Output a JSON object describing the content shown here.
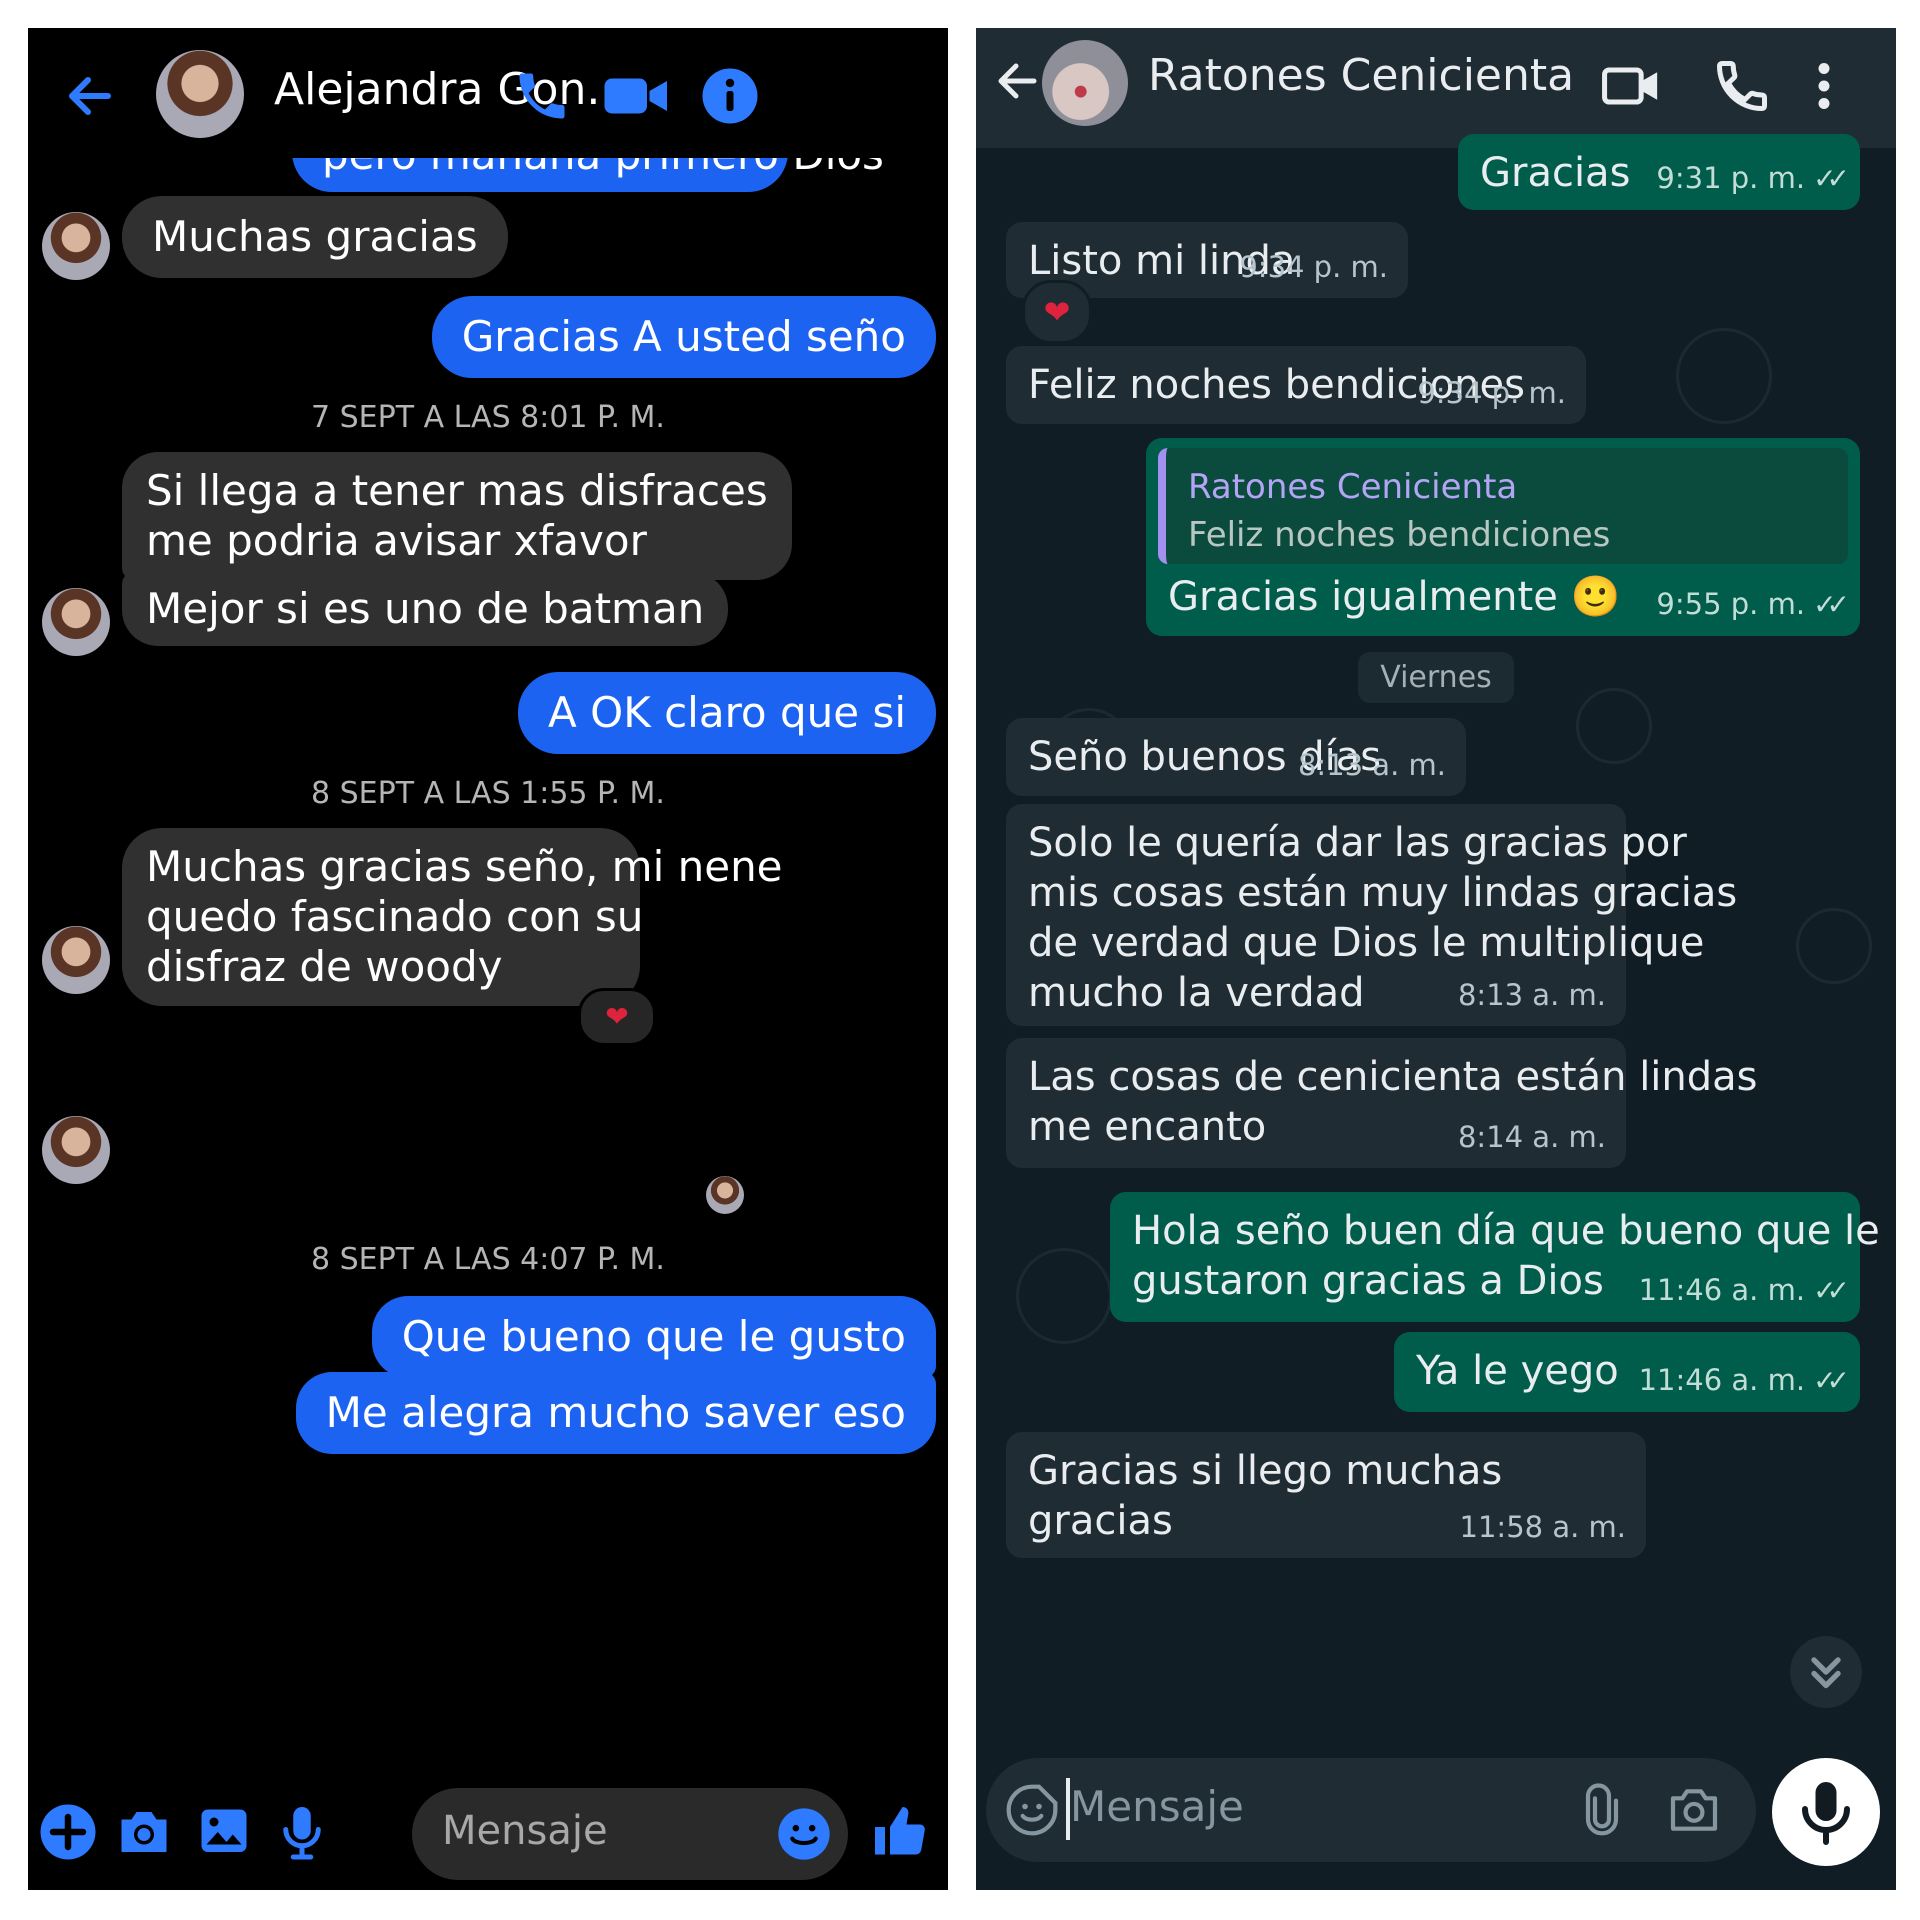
{
  "messenger": {
    "header": {
      "contact_name": "Alejandra Gon..."
    },
    "cut_off_message": "pero mañana primero Dios",
    "messages": [
      {
        "id": "m1",
        "dir": "in",
        "text": "Muchas gracias"
      },
      {
        "id": "m2",
        "dir": "out",
        "text": "Gracias A usted seño"
      },
      {
        "id": "ts1",
        "timestamp": "7 SEPT A LAS 8:01 P. M."
      },
      {
        "id": "m3",
        "dir": "in",
        "lines": [
          "Si llega a tener mas disfraces",
          "me podria avisar xfavor"
        ]
      },
      {
        "id": "m4",
        "dir": "in",
        "text": "Mejor si es uno de batman"
      },
      {
        "id": "m5",
        "dir": "out",
        "text": "A OK claro que si"
      },
      {
        "id": "ts2",
        "timestamp": "8 SEPT A LAS 1:55 P. M."
      },
      {
        "id": "m6",
        "dir": "in",
        "lines": [
          "Muchas gracias seño, mi nene",
          "quedo fascinado con su",
          "disfraz de woody"
        ],
        "reaction": "heart"
      },
      {
        "id": "m7",
        "dir": "in",
        "emoji": [
          "😃",
          "😍"
        ]
      },
      {
        "id": "ts3",
        "timestamp": "8 SEPT A LAS 4:07 P. M."
      },
      {
        "id": "m8",
        "dir": "out",
        "text": "Que bueno que le gusto"
      },
      {
        "id": "m9",
        "dir": "out",
        "text": "Me alegra mucho saver eso"
      }
    ],
    "composer": {
      "placeholder": "Mensaje"
    },
    "colors": {
      "accent": "#1c63f2",
      "incoming": "#303030",
      "background": "#000000"
    }
  },
  "whatsapp": {
    "header": {
      "contact_name": "Ratones Cenicienta"
    },
    "messages": [
      {
        "id": "w1",
        "dir": "out",
        "text": "Gracias",
        "time": "9:31 p. m.",
        "read": true
      },
      {
        "id": "w2",
        "dir": "in",
        "text": "Listo mi linda",
        "time": "9:34 p. m.",
        "reaction": "heart"
      },
      {
        "id": "w3",
        "dir": "in",
        "text": "Feliz noches bendiciones",
        "time": "9:34 p. m."
      },
      {
        "id": "w4",
        "dir": "out",
        "quote_author": "Ratones Cenicienta",
        "quote_text": "Feliz noches bendiciones",
        "text": "Gracias igualmente 🙂",
        "time": "9:55 p. m.",
        "read": true
      },
      {
        "id": "day1",
        "day_label": "Viernes"
      },
      {
        "id": "w5",
        "dir": "in",
        "text": "Seño buenos días",
        "time": "8:13 a. m."
      },
      {
        "id": "w6",
        "dir": "in",
        "lines": [
          "Solo le quería dar las gracias por",
          "mis cosas están muy lindas gracias",
          "de verdad que Dios le multiplique",
          "mucho la verdad"
        ],
        "time": "8:13 a. m."
      },
      {
        "id": "w7",
        "dir": "in",
        "lines": [
          "Las cosas de cenicienta están lindas",
          "me encanto"
        ],
        "time": "8:14 a. m."
      },
      {
        "id": "w8",
        "dir": "out",
        "lines": [
          "Hola seño buen día que bueno que le",
          "gustaron gracias a Dios"
        ],
        "time": "11:46 a. m.",
        "read": true
      },
      {
        "id": "w9",
        "dir": "out",
        "text": "Ya le yego",
        "time": "11:46 a. m.",
        "read": true
      },
      {
        "id": "w10",
        "dir": "in",
        "text": "Gracias si llego muchas gracias",
        "time": "11:58 a. m."
      }
    ],
    "composer": {
      "placeholder": "Mensaje"
    },
    "colors": {
      "outgoing": "#005c4b",
      "incoming": "#202c33",
      "background": "#101d25",
      "quote_bar": "#a390f0"
    }
  }
}
